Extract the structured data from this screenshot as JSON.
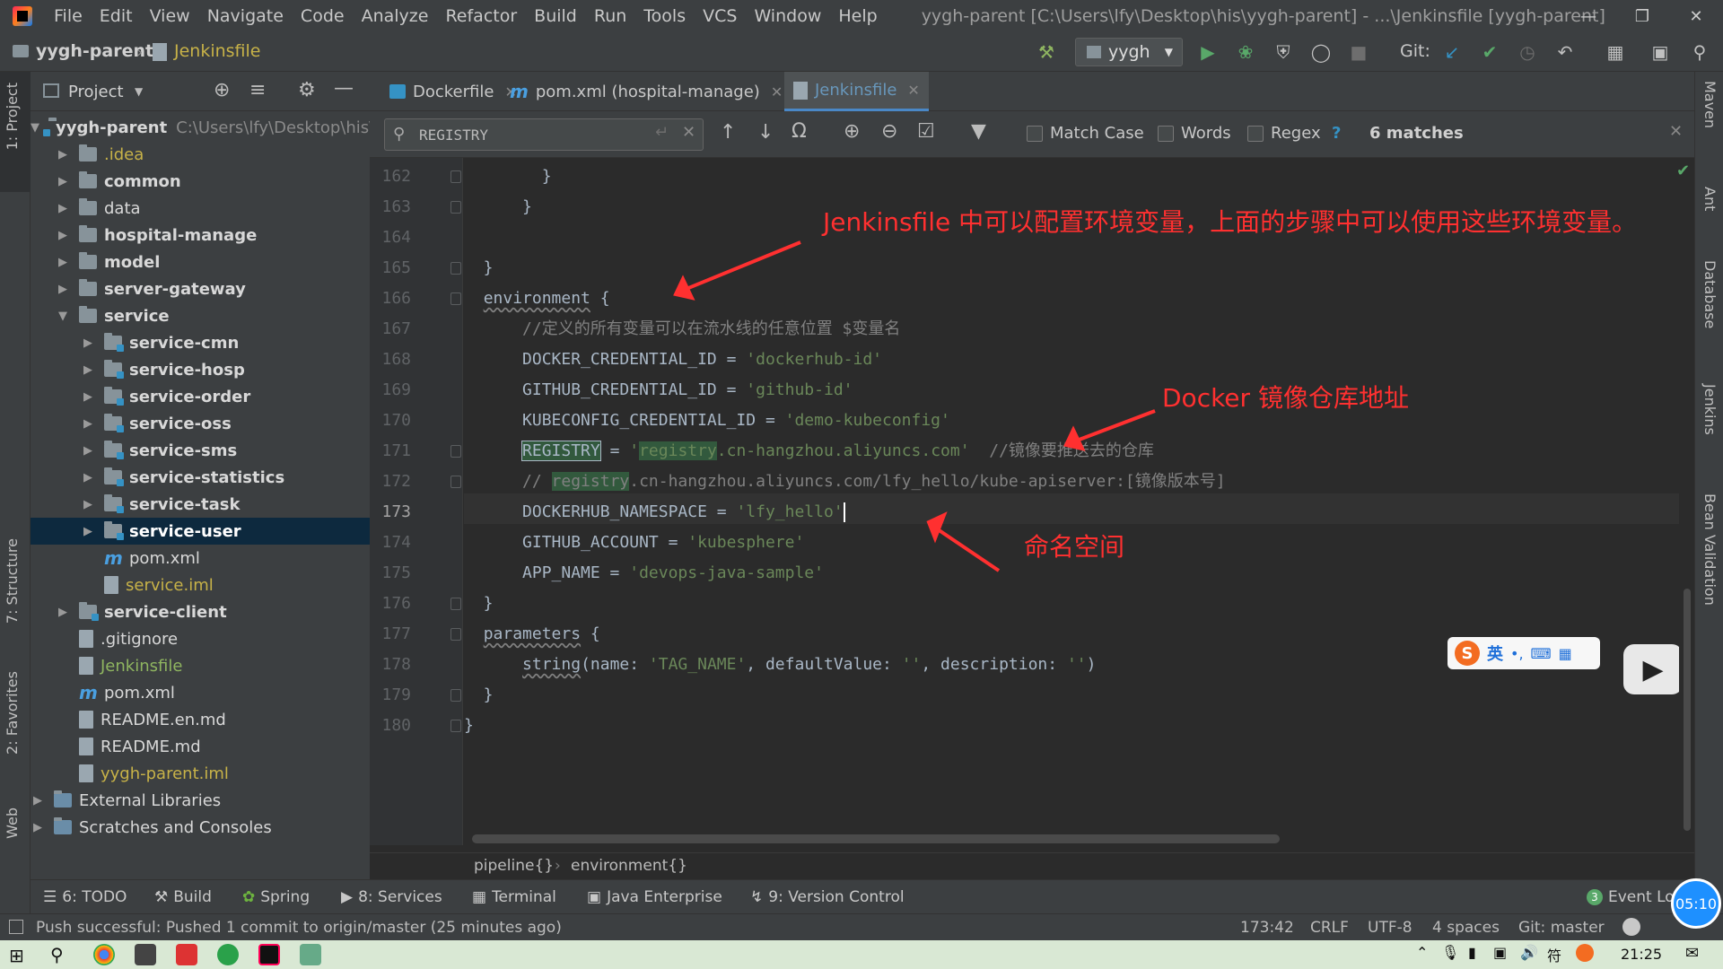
{
  "menu": [
    "File",
    "Edit",
    "View",
    "Navigate",
    "Code",
    "Analyze",
    "Refactor",
    "Build",
    "Run",
    "Tools",
    "VCS",
    "Window",
    "Help"
  ],
  "window_title": "yygh-parent [C:\\Users\\lfy\\Desktop\\his\\yygh-parent] - ...\\Jenkinsfile [yygh-parent]",
  "breadcrumb": {
    "project": "yygh-parent",
    "file": "Jenkinsfile"
  },
  "run_config": "yygh",
  "git_label": "Git:",
  "project_panel": {
    "title": "Project",
    "root": "yygh-parent",
    "root_path": "C:\\Users\\lfy\\Desktop\\his\\"
  },
  "tree": [
    {
      "label": ".idea",
      "type": "folder",
      "level": 1,
      "arrow": "▶",
      "style": "yellow"
    },
    {
      "label": "common",
      "type": "folder",
      "level": 1,
      "arrow": "▶",
      "style": "bold"
    },
    {
      "label": "data",
      "type": "folder",
      "level": 1,
      "arrow": "▶",
      "style": ""
    },
    {
      "label": "hospital-manage",
      "type": "folder",
      "level": 1,
      "arrow": "▶",
      "style": "bold"
    },
    {
      "label": "model",
      "type": "folder",
      "level": 1,
      "arrow": "▶",
      "style": "bold"
    },
    {
      "label": "server-gateway",
      "type": "folder",
      "level": 1,
      "arrow": "▶",
      "style": "bold"
    },
    {
      "label": "service",
      "type": "folder",
      "level": 1,
      "arrow": "▼",
      "style": "bold"
    },
    {
      "label": "service-cmn",
      "type": "folder",
      "level": 2,
      "arrow": "▶",
      "style": "bold"
    },
    {
      "label": "service-hosp",
      "type": "folder",
      "level": 2,
      "arrow": "▶",
      "style": "bold"
    },
    {
      "label": "service-order",
      "type": "folder",
      "level": 2,
      "arrow": "▶",
      "style": "bold"
    },
    {
      "label": "service-oss",
      "type": "folder",
      "level": 2,
      "arrow": "▶",
      "style": "bold"
    },
    {
      "label": "service-sms",
      "type": "folder",
      "level": 2,
      "arrow": "▶",
      "style": "bold"
    },
    {
      "label": "service-statistics",
      "type": "folder",
      "level": 2,
      "arrow": "▶",
      "style": "bold"
    },
    {
      "label": "service-task",
      "type": "folder",
      "level": 2,
      "arrow": "▶",
      "style": "bold"
    },
    {
      "label": "service-user",
      "type": "folder",
      "level": 2,
      "arrow": "▶",
      "style": "bold",
      "selected": true
    },
    {
      "label": "pom.xml",
      "type": "maven",
      "level": 2,
      "arrow": "",
      "style": ""
    },
    {
      "label": "service.iml",
      "type": "file",
      "level": 2,
      "arrow": "",
      "style": "yellow"
    },
    {
      "label": "service-client",
      "type": "folder",
      "level": 1,
      "arrow": "▶",
      "style": "bold"
    },
    {
      "label": ".gitignore",
      "type": "file",
      "level": 1,
      "arrow": "",
      "style": ""
    },
    {
      "label": "Jenkinsfile",
      "type": "file",
      "level": 1,
      "arrow": "",
      "style": "green"
    },
    {
      "label": "pom.xml",
      "type": "maven",
      "level": 1,
      "arrow": "",
      "style": ""
    },
    {
      "label": "README.en.md",
      "type": "file",
      "level": 1,
      "arrow": "",
      "style": ""
    },
    {
      "label": "README.md",
      "type": "file",
      "level": 1,
      "arrow": "",
      "style": ""
    },
    {
      "label": "yygh-parent.iml",
      "type": "file",
      "level": 1,
      "arrow": "",
      "style": "yellow"
    },
    {
      "label": "External Libraries",
      "type": "lib",
      "level": 0,
      "arrow": "▶",
      "style": ""
    },
    {
      "label": "Scratches and Consoles",
      "type": "lib",
      "level": 0,
      "arrow": "▶",
      "style": ""
    }
  ],
  "tabs": [
    {
      "label": "Dockerfile"
    },
    {
      "label": "pom.xml (hospital-manage)"
    },
    {
      "label": "Jenkinsfile",
      "active": true
    }
  ],
  "search": {
    "value": "REGISTRY",
    "match_case": "Match Case",
    "words": "Words",
    "regex": "Regex",
    "help": "?",
    "matches": "6 matches"
  },
  "line_numbers": [
    "162",
    "163",
    "164",
    "165",
    "166",
    "167",
    "168",
    "169",
    "170",
    "171",
    "172",
    "173",
    "174",
    "175",
    "176",
    "177",
    "178",
    "179",
    "180"
  ],
  "code": {
    "l162": "        }",
    "l163": "      }",
    "l165": "  }",
    "l166_kw": "environment",
    "l166_rest": " {",
    "l167": "      //定义的所有变量可以在流水线的任意位置 $变量名",
    "l168_key": "      DOCKER_CREDENTIAL_ID = ",
    "l168_val": "'dockerhub-id'",
    "l169_key": "      GITHUB_CREDENTIAL_ID = ",
    "l169_val": "'github-id'",
    "l170_key": "      KUBECONFIG_CREDENTIAL_ID = ",
    "l170_val": "'demo-kubeconfig'",
    "l171_indent": "      ",
    "l171_key": "REGISTRY",
    "l171_eq": " = ",
    "l171_q": "'",
    "l171_hl": "registry",
    "l171_rest": ".cn-hangzhou.aliyuncs.com'",
    "l171_cmt": "  //镜像要推送去的仓库",
    "l172_pre": "      // ",
    "l172_hl": "registry",
    "l172_rest": ".cn-hangzhou.aliyuncs.com/lfy_hello/kube-apiserver:[镜像版本号]",
    "l173_key": "      DOCKERHUB_NAMESPACE = ",
    "l173_val": "'lfy_hello'",
    "l174_key": "      GITHUB_ACCOUNT = ",
    "l174_val": "'kubesphere'",
    "l175_key": "      APP_NAME = ",
    "l175_val": "'devops-java-sample'",
    "l176": "  }",
    "l177_kw": "parameters",
    "l177_rest": " {",
    "l178_fn": "string",
    "l178_rest": "(name: ",
    "l178_v1": "'TAG_NAME'",
    "l178_mid": ", defaultValue: ",
    "l178_v2": "''",
    "l178_mid2": ", description: ",
    "l178_v3": "''",
    "l178_end": ")",
    "l179": "  }",
    "l180": "}"
  },
  "annotations": {
    "a1": "Jenkinsfile 中可以配置环境变量，上面的步骤中可以使用这些环境变量。",
    "a2": "Docker 镜像仓库地址",
    "a3": "命名空间"
  },
  "ime": {
    "lang": "英"
  },
  "video_time": "05:10",
  "code_crumbs": {
    "a": "pipeline{}",
    "b": "environment{}"
  },
  "bottom_tools": [
    "6: TODO",
    "Build",
    "Spring",
    "8: Services",
    "Terminal",
    "Java Enterprise",
    "9: Version Control",
    "Event Log"
  ],
  "event_count": "3",
  "status": {
    "message": "Push successful: Pushed 1 commit to origin/master (25 minutes ago)",
    "pos": "173:42",
    "eol": "CRLF",
    "enc": "UTF-8",
    "indent": "4 spaces",
    "git": "Git: master"
  },
  "left_tabs": [
    "1: Project",
    "7: Structure",
    "2: Favorites",
    "Web"
  ],
  "right_tabs": [
    "Maven",
    "Ant",
    "Database",
    "Jenkins",
    "Bean Validation"
  ],
  "clock": "21:25",
  "colors": {
    "accent": "#4a88c7",
    "annotation": "#ff3030",
    "string": "#6a8759",
    "keyword": "#cc7832"
  }
}
